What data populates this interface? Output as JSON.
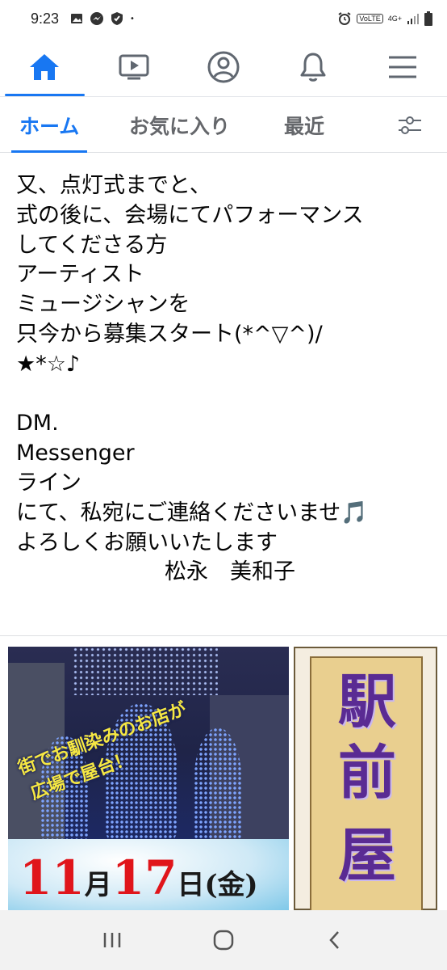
{
  "status_bar": {
    "time": "9:23",
    "left_icons": [
      "image-icon",
      "messenger-icon",
      "shield-icon"
    ],
    "dot": "•",
    "volte": "VoLTE",
    "network": "4G+",
    "right_icons": [
      "alarm-icon",
      "signal-icon",
      "signal-icon",
      "battery-icon"
    ]
  },
  "top_nav": {
    "items": [
      {
        "icon": "home-icon",
        "active": true
      },
      {
        "icon": "video-icon",
        "active": false
      },
      {
        "icon": "profile-icon",
        "active": false
      },
      {
        "icon": "bell-icon",
        "active": false
      },
      {
        "icon": "menu-icon",
        "active": false
      }
    ],
    "accent_color": "#1877f2"
  },
  "tabs": {
    "home": "ホーム",
    "favorites": "お気に入り",
    "recent": "最近",
    "filter_icon": "sliders-icon"
  },
  "post": {
    "lines": [
      "又、点灯式までと、",
      "式の後に、会場にてパフォーマンス",
      "してくださる方",
      "アーティスト",
      "ミュージシャンを",
      "只今から募集スタート(*^▽^)/",
      "★*☆♪",
      "",
      "DM.",
      "Messenger",
      "ライン",
      "にて、私宛にご連絡くださいませ🎵",
      "よろしくお願いいたします"
    ],
    "signature": "松永　美和子"
  },
  "image": {
    "slogan_line1": "街でお馴染みのお店が",
    "slogan_line2": "広場で屋台！",
    "date_month_num": "11",
    "date_month": "月",
    "date_day_num": "17",
    "date_day": "日",
    "date_weekday": "(金)",
    "vertical_title": [
      "駅",
      "前",
      "屋"
    ],
    "title_color": "#5a2b93",
    "date_color": "#e0151b"
  },
  "bottom_nav": {
    "items": [
      "recent-apps-icon",
      "home-circle-icon",
      "back-icon"
    ]
  }
}
